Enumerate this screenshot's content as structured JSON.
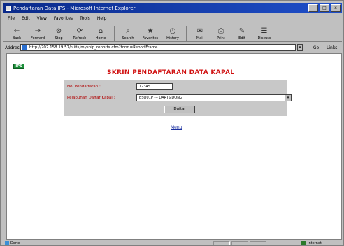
{
  "window": {
    "title": "Pendaftaran Data IPS - Microsoft Internet Explorer",
    "buttons": {
      "minimize": "_",
      "maximize": "□",
      "close": "x"
    }
  },
  "menubar": [
    "File",
    "Edit",
    "View",
    "Favorites",
    "Tools",
    "Help"
  ],
  "toolbar": [
    {
      "label": "Back",
      "icon": "back-arrow-icon",
      "glyph": "←"
    },
    {
      "label": "Forward",
      "icon": "forward-arrow-icon",
      "glyph": "→"
    },
    {
      "label": "Stop",
      "icon": "stop-icon",
      "glyph": "⊗"
    },
    {
      "label": "Refresh",
      "icon": "refresh-icon",
      "glyph": "⟳"
    },
    {
      "label": "Home",
      "icon": "home-icon",
      "glyph": "⌂"
    },
    {
      "label": "Search",
      "icon": "search-icon",
      "glyph": "⌕"
    },
    {
      "label": "Favorites",
      "icon": "favorites-icon",
      "glyph": "★"
    },
    {
      "label": "History",
      "icon": "history-icon",
      "glyph": "◷"
    },
    {
      "label": "Mail",
      "icon": "mail-icon",
      "glyph": "✉"
    },
    {
      "label": "Print",
      "icon": "print-icon",
      "glyph": "⎙"
    },
    {
      "label": "Edit",
      "icon": "edit-icon",
      "glyph": "✎"
    },
    {
      "label": "Discuss",
      "icon": "discuss-icon",
      "glyph": "☰"
    }
  ],
  "address": {
    "label": "Address",
    "url": "http://202.158.19.57/~ifis/myship_reports.cfm?form=ReportFrame",
    "go_label": "Go",
    "links_label": "Links"
  },
  "page": {
    "logo_text": "IPS",
    "title": "SKRIN PENDAFTARAN DATA KAPAL",
    "form": {
      "field1_label": "No. Pendaftaran :",
      "field1_value": "12345",
      "field2_label": "Pelabuhan Daftar Kapal :",
      "field2_value": "BSO01P --- DARTSIDONG",
      "submit_label": "Daftar"
    },
    "menu_link": "Menu"
  },
  "statusbar": {
    "text": "Done",
    "zone": "Internet"
  },
  "colors": {
    "title_red": "#d01010",
    "label_red": "#b00000",
    "link_blue": "#1a2fa0",
    "titlebar_blue": "#0a2a8a",
    "form_bg": "#c8c8c8"
  }
}
